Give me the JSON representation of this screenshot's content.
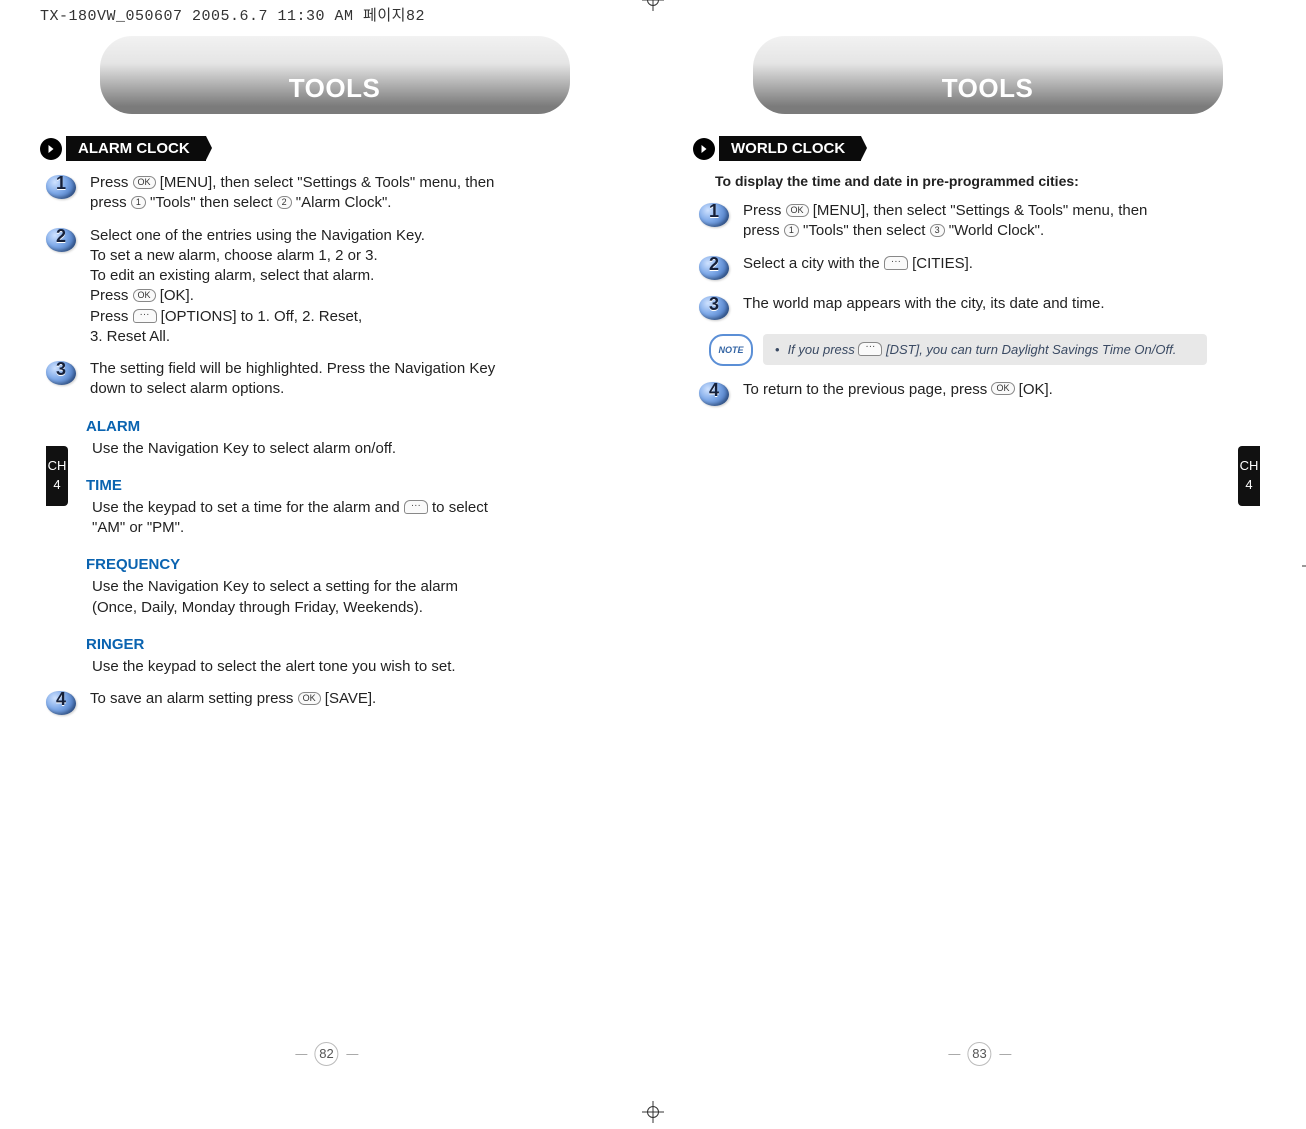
{
  "print_header": "TX-180VW_050607  2005.6.7 11:30 AM  페이지82",
  "side_tab": {
    "letters": "CH",
    "num": "4"
  },
  "crop_marks": true,
  "left": {
    "header": "TOOLS",
    "page_number": "82",
    "section_title": "ALARM CLOCK",
    "steps": [
      {
        "n": "1",
        "parts": [
          "Press ",
          {
            "key": "OK"
          },
          " [MENU], then select \"Settings & Tools\" menu, then press ",
          {
            "key": "1"
          },
          " \"Tools\" then select ",
          {
            "key": "2"
          },
          " \"Alarm Clock\"."
        ]
      },
      {
        "n": "2",
        "parts": [
          "Select one of the entries using the Navigation Key.\nTo set a new alarm, choose alarm 1, 2 or 3.\nTo edit an existing alarm, select that alarm.\nPress ",
          {
            "key": "OK"
          },
          " [OK].\nPress ",
          {
            "dots": true
          },
          " [OPTIONS] to 1. Off, 2. Reset,\n3. Reset All."
        ]
      },
      {
        "n": "3",
        "parts": [
          "The setting field will be highlighted. Press the Navigation Key down to select alarm options."
        ]
      }
    ],
    "subsections": [
      {
        "title": "ALARM",
        "body_parts": [
          "Use the Navigation Key to select alarm on/off."
        ]
      },
      {
        "title": "TIME",
        "body_parts": [
          "Use the keypad to set a time for the alarm and ",
          {
            "dots": true
          },
          " to select \"AM\" or \"PM\"."
        ]
      },
      {
        "title": "FREQUENCY",
        "body_parts": [
          "Use the Navigation Key to select a setting for the alarm (Once, Daily, Monday through Friday, Weekends)."
        ]
      },
      {
        "title": "RINGER",
        "body_parts": [
          "Use the keypad to select the alert tone you wish to set."
        ]
      }
    ],
    "final_step": {
      "n": "4",
      "parts": [
        "To save an alarm setting press ",
        {
          "key": "OK"
        },
        " [SAVE]."
      ]
    }
  },
  "right": {
    "header": "TOOLS",
    "page_number": "83",
    "section_title": "WORLD CLOCK",
    "intro": "To display the time and date in pre-programmed cities:",
    "steps": [
      {
        "n": "1",
        "parts": [
          "Press ",
          {
            "key": "OK"
          },
          " [MENU], then select \"Settings & Tools\" menu, then press ",
          {
            "key": "1"
          },
          " \"Tools\" then select ",
          {
            "key": "3"
          },
          " \"World Clock\"."
        ]
      },
      {
        "n": "2",
        "parts": [
          "Select a city with the ",
          {
            "dots": true
          },
          " [CITIES]."
        ]
      },
      {
        "n": "3",
        "parts": [
          "The world map appears with the city, its date and time."
        ]
      }
    ],
    "note": {
      "badge": "NOTE",
      "parts": [
        "If you press ",
        {
          "dots": true
        },
        " [DST], you can turn Daylight Savings Time On/Off."
      ]
    },
    "final_step": {
      "n": "4",
      "parts": [
        "To return to the previous page, press ",
        {
          "key": "OK"
        },
        " [OK]."
      ]
    }
  }
}
